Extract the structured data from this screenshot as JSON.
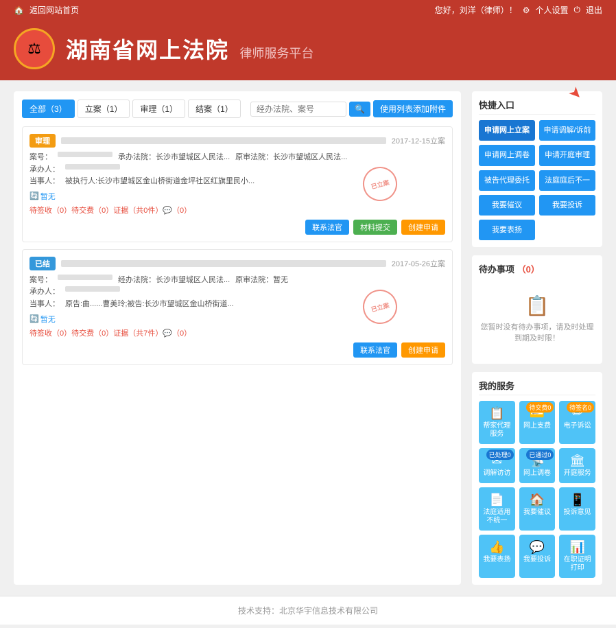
{
  "topnav": {
    "back_label": "返回网站首页",
    "greeting": "您好，刘洋（律师）！",
    "settings_label": "个人设置",
    "logout_label": "退出"
  },
  "header": {
    "title": "湖南省网上法院",
    "subtitle": "律师服务平台",
    "logo_icon": "⚖"
  },
  "tabs": [
    {
      "label": "全部（3）",
      "active": true
    },
    {
      "label": "立案（1）",
      "active": false
    },
    {
      "label": "审理（1）",
      "active": false
    },
    {
      "label": "结案（1）",
      "active": false
    }
  ],
  "search": {
    "placeholder": "经办法院、案号",
    "btn_label": "🔍"
  },
  "add_btn_label": "使用列表添加附件",
  "cases": [
    {
      "status": "审理",
      "badge_class": "badge-orange",
      "date": "2017-12-15立案",
      "case_no_label": "案号：",
      "case_no_value": "",
      "manager_label": "承办法院：长沙市望城区人民法...",
      "original_label": "原审法院：长沙市望城区人民法...",
      "handler_label": "承办人：",
      "handler_value": "",
      "party_label": "当事人：",
      "party_value": "被执行人:长沙市望城区金山桥街道金坪社区红旗里民小...",
      "link_label": "暂无",
      "pending": "待签收（0）待交费（0）证据（共0件）💬（0）",
      "stamp_text": "已立案",
      "actions": [
        {
          "label": "联系法官",
          "class": "btn-blue"
        },
        {
          "label": "材料提交",
          "class": "btn-green"
        },
        {
          "label": "创建申请",
          "class": "btn-orange"
        }
      ]
    },
    {
      "status": "已结",
      "badge_class": "badge-blue",
      "date": "2017-05-26立案",
      "case_no_label": "案号：",
      "case_no_value": "",
      "manager_label": "经办法院：长沙市望城区人民法...",
      "original_label": "原审法院：暂无",
      "handler_label": "承办人：",
      "handler_value": "",
      "party_label": "当事人：",
      "party_value": "原告:曲......曹美玲;被告:长沙市望城区金山桥街道...",
      "link_label": "暂无",
      "pending": "待签收（0）待交费（0）证据（共7件）💬（0）",
      "stamp_text": "已立案",
      "actions": [
        {
          "label": "联系法官",
          "class": "btn-blue"
        },
        {
          "label": "创建申请",
          "class": "btn-orange"
        }
      ]
    }
  ],
  "quick_access": {
    "title": "快捷入口",
    "arrow_note": "红色箭头指向申请网上立案按钮",
    "buttons": [
      {
        "label": "申请网上立案",
        "highlighted": true
      },
      {
        "label": "申请调解/诉前"
      },
      {
        "label": "申请网上调卷"
      },
      {
        "label": "申请开庭审理"
      },
      {
        "label": "被告代理委托"
      },
      {
        "label": "法庭庭后不一"
      },
      {
        "label": "我要催议"
      },
      {
        "label": "我要投诉"
      },
      {
        "label": "我要表扬"
      }
    ]
  },
  "pending_tasks": {
    "title": "待办事项",
    "count": "（0）",
    "empty_message": "您暂时没有待办事项，请及时处理到期及时限！"
  },
  "my_services": {
    "title": "我的服务",
    "items": [
      {
        "icon": "📋",
        "label": "帮家代理服\n务",
        "badge": null
      },
      {
        "icon": "💳",
        "label": "网上支费",
        "badge": "待交费0",
        "badge_class": ""
      },
      {
        "icon": "✏",
        "label": "电子诉讼",
        "badge": "待签名0",
        "badge_class": ""
      },
      {
        "icon": "✉",
        "label": "调解访访",
        "badge": "已处理0",
        "badge_class": "blue"
      },
      {
        "icon": "📡",
        "label": "网上调卷",
        "badge": "已通过0",
        "badge_class": "blue"
      },
      {
        "icon": "🏛",
        "label": "开庭服务",
        "badge": null
      },
      {
        "icon": "📄",
        "label": "法庭适用不\n统一",
        "badge": null
      },
      {
        "icon": "🏠",
        "label": "我要催议",
        "badge": null
      },
      {
        "icon": "📱",
        "label": "投诉意见",
        "badge": null
      },
      {
        "icon": "👍",
        "label": "我要表扬",
        "badge": null
      },
      {
        "icon": "💬",
        "label": "我要投诉",
        "badge": null
      },
      {
        "icon": "📊",
        "label": "在职证明打\n印服务",
        "badge": null
      }
    ]
  },
  "footer": {
    "text": "技术支持：北京华宇信息技术有限公司"
  }
}
